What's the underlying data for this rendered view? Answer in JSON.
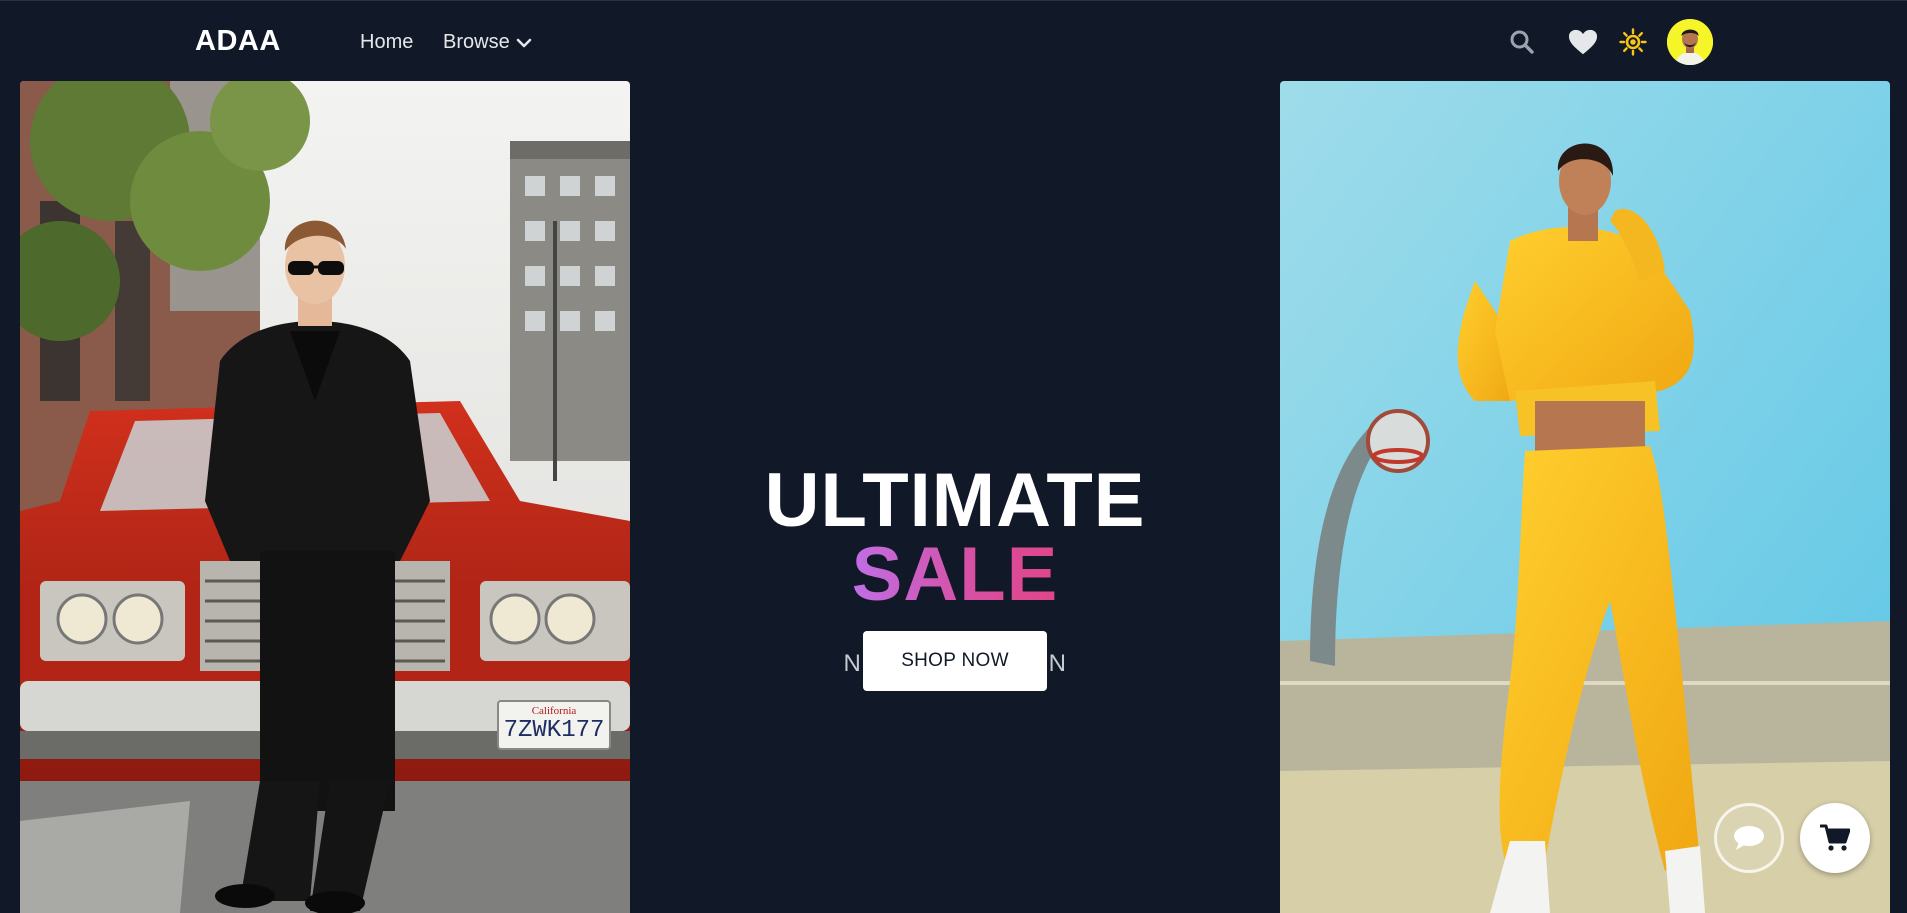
{
  "header": {
    "brand": "ADAA",
    "nav": {
      "home_label": "Home",
      "browse_label": "Browse"
    },
    "icons": [
      "search-icon",
      "heart-icon",
      "sun-icon",
      "avatar"
    ]
  },
  "hero": {
    "title_line1": "ULTIMATE",
    "title_line2": "SALE",
    "subtitle": "NEW COLLECTION",
    "cta_label": "SHOP NOW"
  },
  "images": {
    "left": "man-leaning-on-red-car-photo",
    "right": "woman-in-yellow-tracksuit-photo"
  },
  "fabs": {
    "chat": "chat-icon",
    "cart": "cart-icon"
  },
  "colors": {
    "background": "#111827",
    "accent_gradient_start": "#c06ee6",
    "accent_gradient_end": "#e0468a",
    "sun": "#f5c518",
    "avatar_bg": "#f5f52a"
  }
}
